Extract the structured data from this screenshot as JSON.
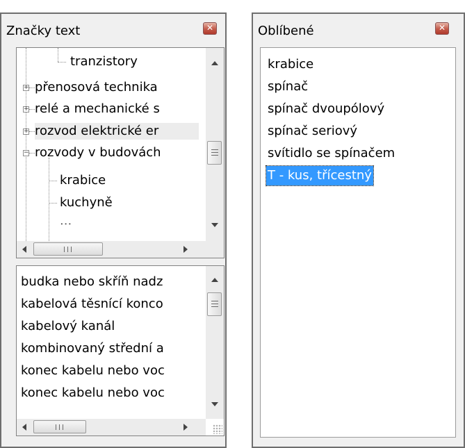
{
  "left_panel": {
    "title": "Značky text",
    "close_label": "x",
    "tree": {
      "items": [
        {
          "label": "tranzistory",
          "expander": ""
        },
        {
          "label": "přenosová technika",
          "expander": "+"
        },
        {
          "label": "relé a mechanické s",
          "expander": "+"
        },
        {
          "label": "rozvod elektrické er",
          "expander": "+"
        },
        {
          "label": "rozvody v budovách",
          "expander": "−"
        },
        {
          "label": "krabice",
          "expander": ""
        },
        {
          "label": "kuchyně",
          "expander": ""
        },
        {
          "label": "...",
          "expander": ""
        }
      ]
    },
    "symbols": {
      "items": [
        "budka nebo skříň nadz",
        "kabelová těsnící konco",
        "kabelový kanál",
        "kombinovaný střední a",
        "konec kabelu nebo voc",
        "konec kabelu nebo voc"
      ]
    },
    "scroll_glyphs": {
      "up": "▲",
      "down": "▼",
      "left": "◀",
      "right": "▶"
    }
  },
  "right_panel": {
    "title": "Oblíbené",
    "close_label": "x",
    "items": [
      "krabice",
      "spínač",
      "spínač dvoupólový",
      "spínač seriový",
      "svítidlo se spínačem",
      "T - kus, třícestný"
    ],
    "selected_index": 5
  },
  "colors": {
    "selection": "#3399ff",
    "close_button": "#c35a4a",
    "panel_bg": "#f0f0f0"
  }
}
